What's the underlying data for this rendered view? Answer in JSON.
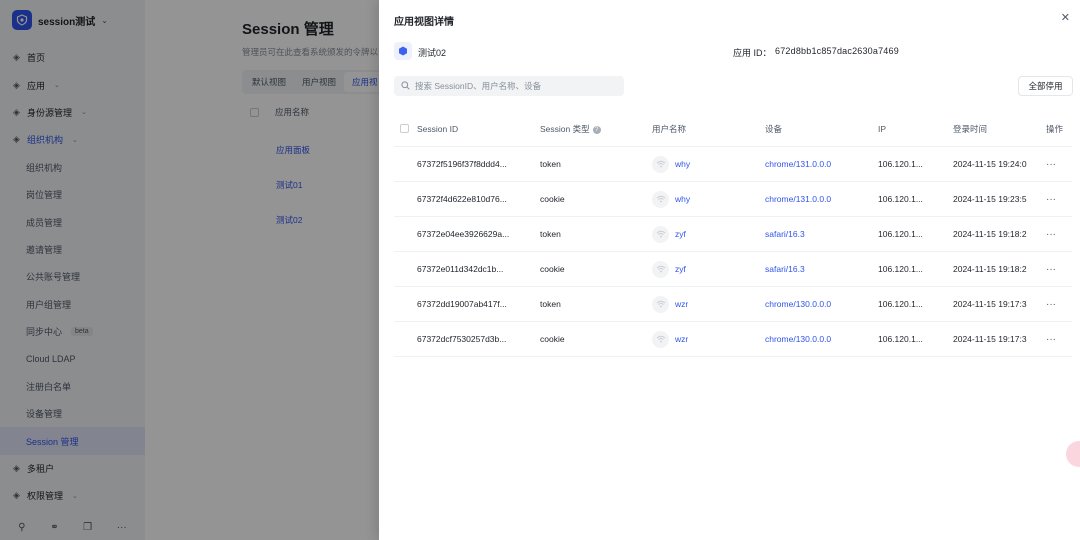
{
  "sidebar": {
    "brand_name": "session测试",
    "items": [
      {
        "label": "首页",
        "icon": "home-icon",
        "level": 0
      },
      {
        "label": "应用",
        "icon": "app-icon",
        "level": 0,
        "caret": true
      },
      {
        "label": "身份源管理",
        "icon": "identity-icon",
        "level": 0,
        "caret": true
      },
      {
        "label": "组织机构",
        "icon": "org-icon",
        "level": 0,
        "caret": true,
        "open": true
      },
      {
        "label": "组织机构",
        "level": 1
      },
      {
        "label": "岗位管理",
        "level": 1
      },
      {
        "label": "成员管理",
        "level": 1
      },
      {
        "label": "邀请管理",
        "level": 1
      },
      {
        "label": "公共账号管理",
        "level": 1
      },
      {
        "label": "用户组管理",
        "level": 1
      },
      {
        "label": "同步中心",
        "level": 1,
        "badge": "beta"
      },
      {
        "label": "Cloud LDAP",
        "level": 1
      },
      {
        "label": "注册白名单",
        "level": 1
      },
      {
        "label": "设备管理",
        "level": 1
      },
      {
        "label": "Session 管理",
        "level": 1,
        "active": true
      },
      {
        "label": "多租户",
        "icon": "tenant-icon",
        "level": 0
      },
      {
        "label": "权限管理",
        "icon": "permission-icon",
        "level": 0,
        "caret": true
      }
    ]
  },
  "page": {
    "title": "Session 管理",
    "description": "管理员可在此查看系统颁发的令牌以",
    "tabs": [
      "默认视图",
      "用户视图",
      "应用视"
    ],
    "table_header": "应用名称",
    "rows": [
      "应用面板",
      "测试01",
      "测试02"
    ]
  },
  "drawer": {
    "title": "应用视图详情",
    "close_icon": "close-icon",
    "app_name": "测试02",
    "app_id_label": "应用 ID：",
    "app_id": "672d8bb1c857dac2630a7469",
    "search_placeholder": "搜索 SessionID、用户名称、设备",
    "disable_all_label": "全部停用",
    "columns": {
      "id": "Session ID",
      "type": "Session 类型",
      "user": "用户名称",
      "device": "设备",
      "ip": "IP",
      "time": "登录时间",
      "op": "操作"
    },
    "rows": [
      {
        "id": "67372f5196f37f8ddd4...",
        "type": "token",
        "user": "why",
        "device": "chrome/131.0.0.0",
        "ip": "106.120.1...",
        "time": "2024-11-15 19:24:0"
      },
      {
        "id": "67372f4d622e810d76...",
        "type": "cookie",
        "user": "why",
        "device": "chrome/131.0.0.0",
        "ip": "106.120.1...",
        "time": "2024-11-15 19:23:5"
      },
      {
        "id": "67372e04ee3926629a...",
        "type": "token",
        "user": "zyf",
        "device": "safari/16.3",
        "ip": "106.120.1...",
        "time": "2024-11-15 19:18:2"
      },
      {
        "id": "67372e011d342dc1b...",
        "type": "cookie",
        "user": "zyf",
        "device": "safari/16.3",
        "ip": "106.120.1...",
        "time": "2024-11-15 19:18:2"
      },
      {
        "id": "67372dd19007ab417f...",
        "type": "token",
        "user": "wzr",
        "device": "chrome/130.0.0.0",
        "ip": "106.120.1...",
        "time": "2024-11-15 19:17:3"
      },
      {
        "id": "67372dcf7530257d3b...",
        "type": "cookie",
        "user": "wzr",
        "device": "chrome/130.0.0.0",
        "ip": "106.120.1...",
        "time": "2024-11-15 19:17:3"
      }
    ]
  },
  "colors": {
    "accent": "#2f54eb",
    "overlay": "rgba(0,0,0,0.42)",
    "sidebar_bg": "#f2f3f5"
  }
}
